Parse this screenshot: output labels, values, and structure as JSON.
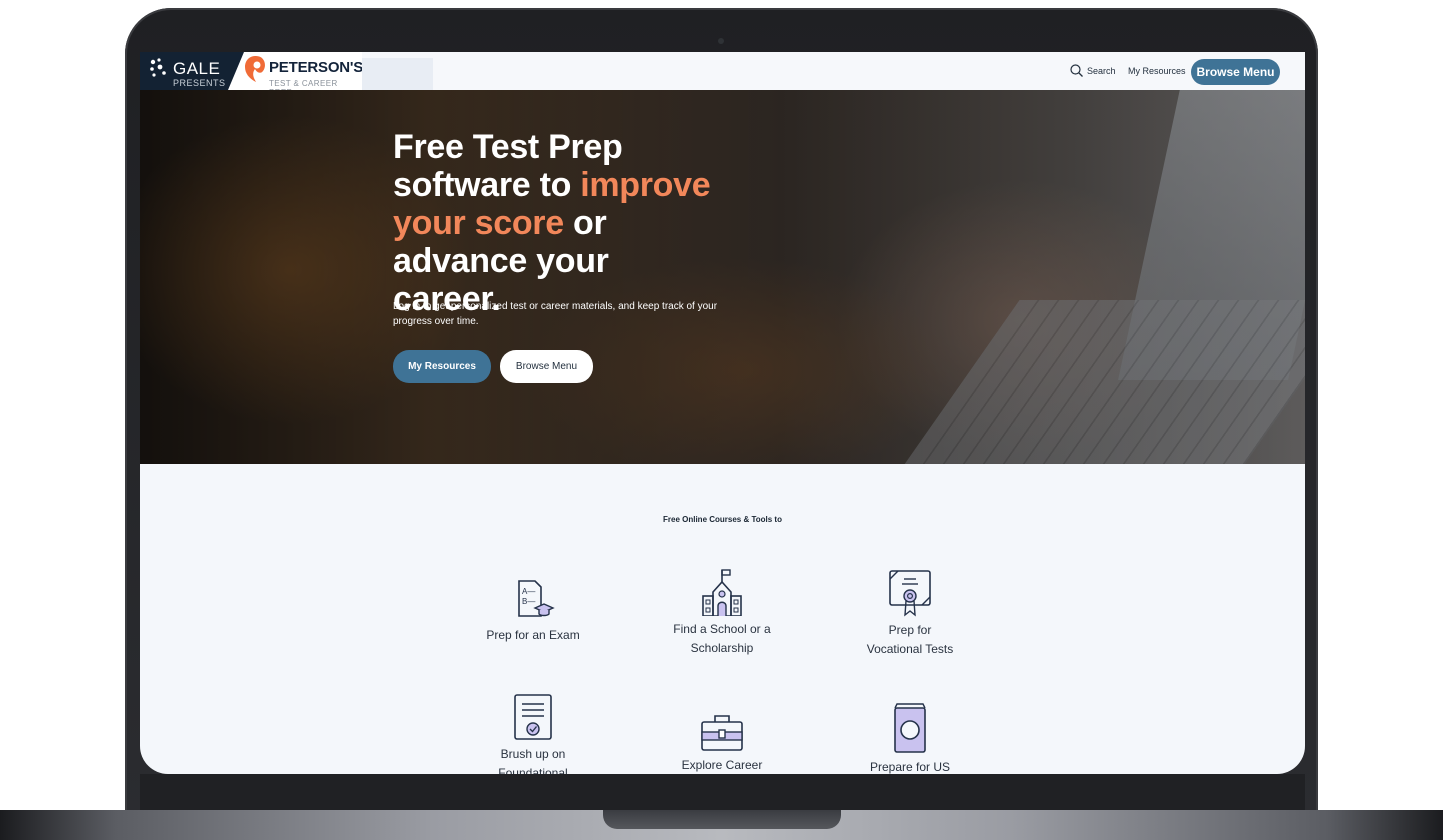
{
  "header": {
    "gale_brand": "GALE",
    "gale_sub": "PRESENTS",
    "peterson_brand": "PETERSON'S",
    "peterson_sub": "TEST & CAREER PREP",
    "search_label": "Search",
    "resources_link": "My Resources",
    "browse_button": "Browse Menu"
  },
  "hero": {
    "title_part1": "Free Test Prep software to ",
    "title_highlight": "improve your score",
    "title_part2": " or advance your career.",
    "body": "Log in to get personalized test or career materials, and keep track of your progress over time.",
    "primary_button": "My Resources",
    "secondary_button": "Browse Menu"
  },
  "courses": {
    "heading": "Free Online Courses & Tools to",
    "tiles": [
      {
        "label": "Prep for an Exam",
        "icon": "exam-icon"
      },
      {
        "label": "Find a School or a Scholarship",
        "icon": "school-icon"
      },
      {
        "label": "Prep for Vocational Tests",
        "icon": "certificate-icon"
      },
      {
        "label": "Brush up on Foundational",
        "icon": "document-check-icon"
      },
      {
        "label": "Explore Career",
        "icon": "briefcase-icon"
      },
      {
        "label": "Prepare for US",
        "icon": "passport-icon"
      }
    ]
  },
  "colors": {
    "accent": "#3f7396",
    "highlight": "#f2875a",
    "navy": "#132233"
  }
}
